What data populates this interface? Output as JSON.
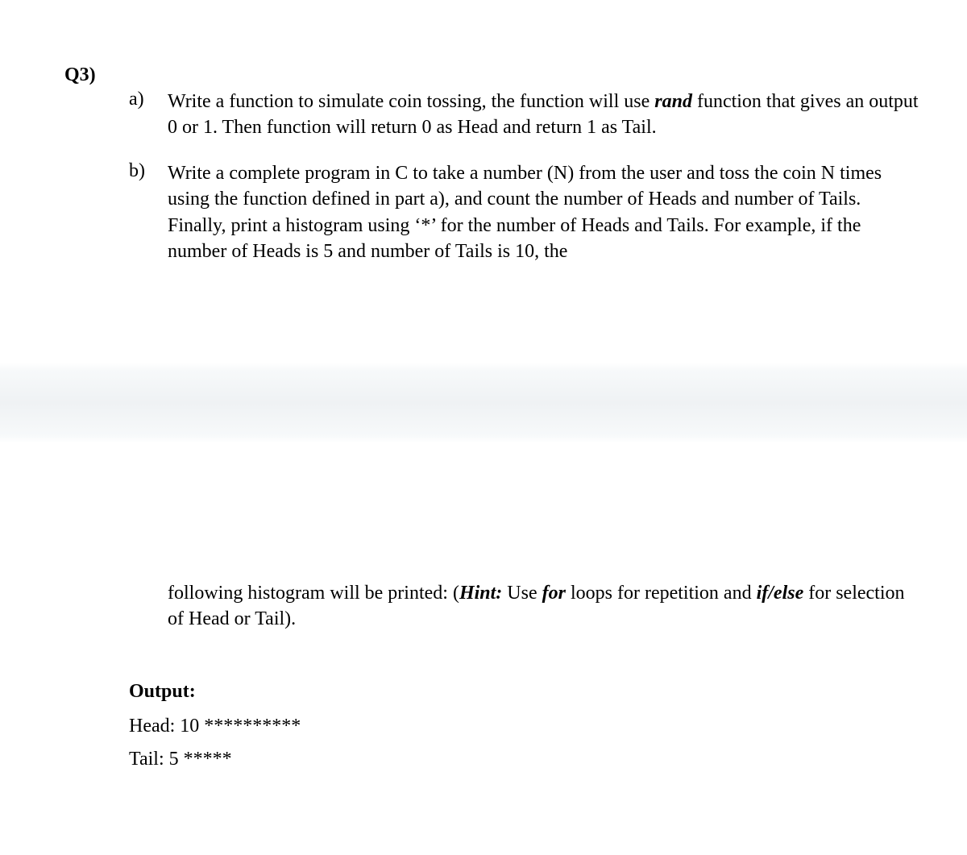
{
  "question": {
    "number": "Q3)",
    "parts": {
      "a": {
        "label": "a)",
        "text_before_rand": "Write a function to simulate coin tossing, the function will use ",
        "rand": "rand",
        "text_after_rand": " function that gives an output 0 or 1. Then function will return 0 as Head and return 1 as Tail."
      },
      "b": {
        "label": "b)",
        "text": "Write a complete program in C to take a number (N) from the user and toss the coin N times using the function defined in part a), and count the number of Heads and number of Tails. Finally, print a histogram using ‘*’ for the number of Heads and Tails. For example, if the number of Heads is 5 and number of Tails is 10, the"
      }
    },
    "continuation": {
      "text_before_hint": "following histogram will be printed: (",
      "hint_label": "Hint:",
      "text_mid1": " Use ",
      "for_word": "for",
      "text_mid2": " loops for repetition and ",
      "ifelse_word": "if/else",
      "text_after": " for selection of Head or Tail)."
    },
    "output": {
      "label": "Output:",
      "head_line": "Head: 10 **********",
      "tail_line": "Tail:   5 *****"
    }
  }
}
